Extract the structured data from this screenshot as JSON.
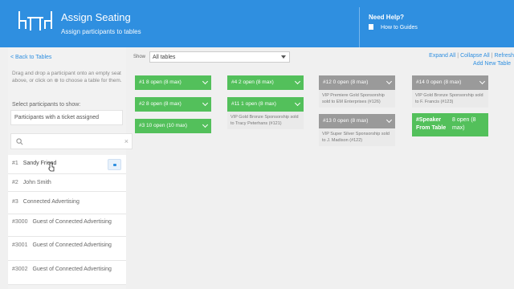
{
  "header": {
    "title": "Assign Seating",
    "subtitle": "Assign participants to tables",
    "help_title": "Need Help?",
    "help_link": "How to Guides",
    "bg_color": "#2f8fe0"
  },
  "sidebar": {
    "back": "< Back to Tables",
    "instructions": "Drag and drop a participant onto an empty seat above, or click on ⊕ to choose a table for them.",
    "select_label": "Select participants to show:",
    "filter_value": "Participants with a ticket assigned",
    "search_placeholder": "",
    "participants": [
      {
        "num": "#1",
        "name": "Sandy Friend"
      },
      {
        "num": "#2",
        "name": "John Smith"
      },
      {
        "num": "#3",
        "name": "Connected Advertising"
      },
      {
        "num": "#3000",
        "name": "Guest of Connected Advertising"
      },
      {
        "num": "#3001",
        "name": "Guest of Connected Advertising"
      },
      {
        "num": "#3002",
        "name": "Guest of Connected Advertising"
      }
    ]
  },
  "main": {
    "show_label": "Show",
    "tables_select": "All tables",
    "links": {
      "expand": "Expand All",
      "collapse": "Collapse All",
      "refresh": "Refresh",
      "add": "Add New Table"
    },
    "tables": [
      {
        "label": "#1   8 open (8 max)",
        "color": "green",
        "desc": ""
      },
      {
        "label": "#2   8 open (8 max)",
        "color": "green",
        "desc": ""
      },
      {
        "label": "#3   10 open (10 max)",
        "color": "green",
        "desc": ""
      },
      {
        "label": "#4   2 open (8 max)",
        "color": "green",
        "desc": ""
      },
      {
        "label": "#11   1 open (8 max)",
        "color": "green",
        "desc": "VIP Gold Bronze Sponsorship sold to Tracy Peterhans (#121)"
      },
      {
        "label": "#12   0 open (8 max)",
        "color": "grey",
        "desc": "VIP Premiere Gold Sponsorship sold to EM Enterprises (#126)"
      },
      {
        "label": "#13   0 open (8 max)",
        "color": "grey",
        "desc": "VIP Super Silver Sponsorship sold to J. Madison (#122)"
      },
      {
        "label": "#14   0 open (8 max)",
        "color": "grey",
        "desc": "VIP Gold Bronze Sponsorship sold to F. Francis (#123)"
      }
    ],
    "speaker": {
      "label": "#Speaker From Table",
      "status": "8 open (8 max)"
    }
  }
}
